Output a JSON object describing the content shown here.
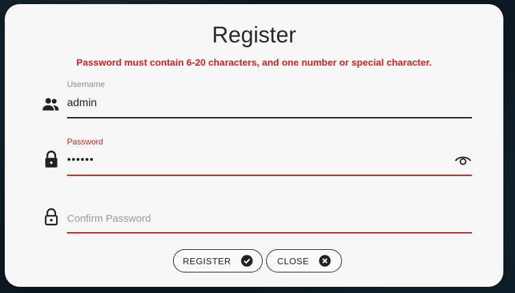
{
  "dialog": {
    "title": "Register",
    "error_message": "Password must contain 6-20 characters, and one number or special character."
  },
  "form": {
    "username": {
      "label": "Username",
      "value": "admin",
      "icon": "people-icon"
    },
    "password": {
      "label": "Password",
      "value": "••••••",
      "icon": "lock-icon",
      "toggle_icon": "eye-icon"
    },
    "confirm_password": {
      "placeholder": "Confirm Password",
      "icon": "unlock-icon"
    }
  },
  "buttons": {
    "register_label": "REGISTER",
    "close_label": "CLOSE"
  },
  "colors": {
    "error": "#d01f1f",
    "dialog_bg": "#f7f7f7",
    "text": "#1e1e1e"
  }
}
